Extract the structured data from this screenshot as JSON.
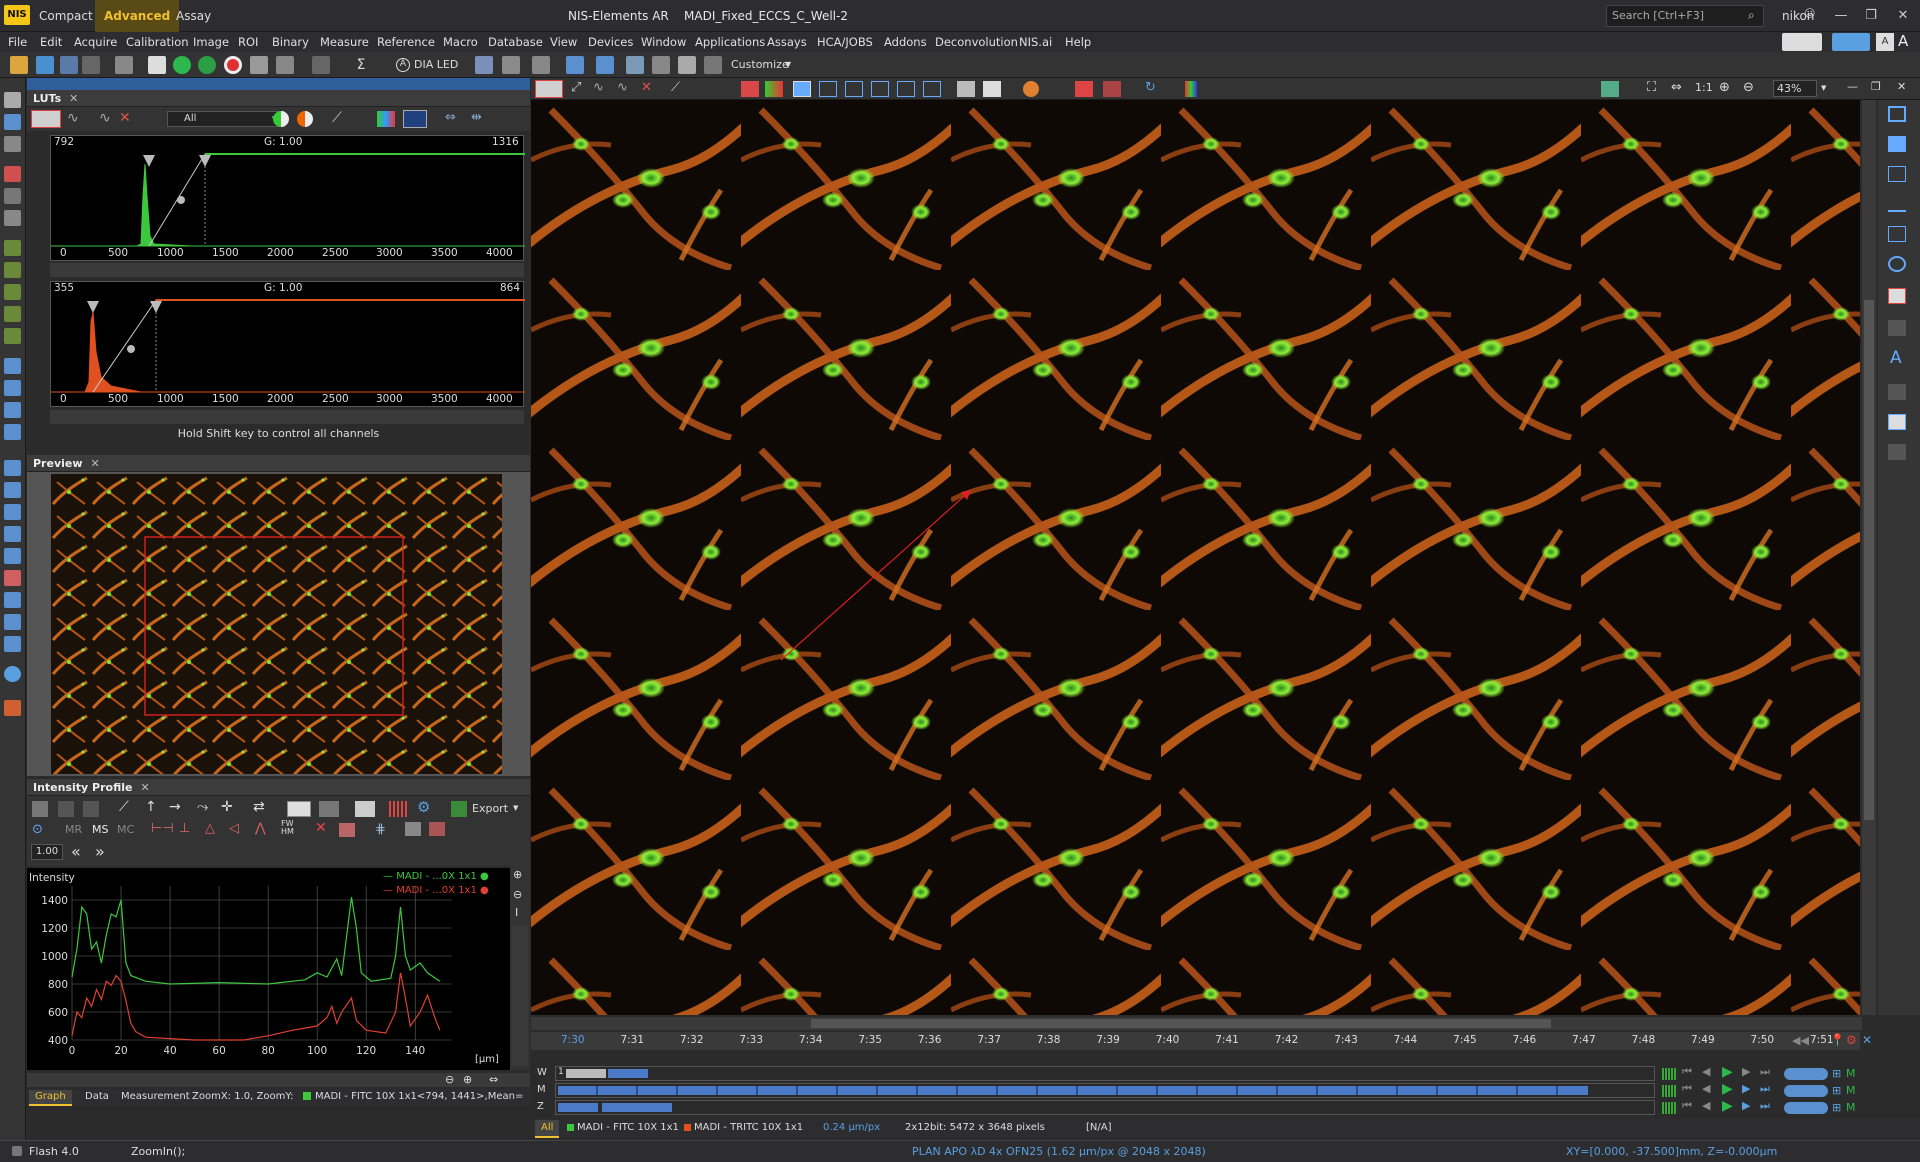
{
  "titlebar": {
    "logo": "NIS",
    "modes": [
      "Compact",
      "Advanced",
      "Assay"
    ],
    "title": "NIS-Elements AR    MADI_Fixed_ECCS_C_Well-2",
    "search_placeholder": "Search [Ctrl+F3]",
    "user": "nikon"
  },
  "menu": [
    "File",
    "Edit",
    "Acquire",
    "Calibration",
    "Image",
    "ROI",
    "Binary",
    "Measure",
    "Reference",
    "Macro",
    "Database",
    "View",
    "Devices",
    "Window",
    "Applications",
    "Assays",
    "HCA/JOBS",
    "Addons",
    "Deconvolution",
    "NIS.ai",
    "Help"
  ],
  "toolbar": {
    "dia_led": "DIA LED",
    "customize": "Customize"
  },
  "luts": {
    "title": "LUTs",
    "channel_select": "All",
    "ch1": {
      "min": "792",
      "gamma": "G: 1.00",
      "max": "1316",
      "color": "#3cc83c"
    },
    "ch2": {
      "min": "355",
      "gamma": "G: 1.00",
      "max": "864",
      "color": "#e05020"
    },
    "axis": [
      "0",
      "500",
      "1000",
      "1500",
      "2000",
      "2500",
      "3000",
      "3500",
      "4000"
    ],
    "hint": "Hold Shift key to control all channels"
  },
  "preview": {
    "title": "Preview"
  },
  "intensity": {
    "title": "Intensity Profile",
    "export": "Export",
    "mr": "MR",
    "ms": "MS",
    "mc": "MC",
    "fwhm": "FW HM",
    "zoom_value": "1.00",
    "ylabel": "Intensity",
    "xunit": "[µm]",
    "yticks": [
      "1400",
      "1200",
      "1000",
      "800",
      "600",
      "400"
    ],
    "xticks": [
      "0",
      "20",
      "40",
      "60",
      "80",
      "100",
      "120",
      "140"
    ],
    "legend": [
      "MADI - ...0X 1x1",
      "MADI - ...0X 1x1"
    ],
    "tabs": [
      "Graph",
      "Data",
      "Measurement"
    ],
    "zoom_info": "ZoomX: 1.0, ZoomY:",
    "channel_info": "MADI - FITC 10X 1x1<794, 1441>,Mean="
  },
  "viewer": {
    "zoom": "43%",
    "ratio": "1:1"
  },
  "timeline": {
    "ticks": [
      "7:30",
      "7:31",
      "7:32",
      "7:33",
      "7:34",
      "7:35",
      "7:36",
      "7:37",
      "7:38",
      "7:39",
      "7:40",
      "7:41",
      "7:42",
      "7:43",
      "7:44",
      "7:45",
      "7:46",
      "7:47",
      "7:48",
      "7:49",
      "7:50",
      "7:51"
    ],
    "rows": [
      "W",
      "M",
      "Z"
    ],
    "w_value": "1"
  },
  "chtabs": {
    "all": "All",
    "fitc": "MADI - FITC 10X 1x1",
    "tritc": "MADI - TRITC 10X 1x1",
    "pixel": "0.24 µm/px",
    "size": "2x12bit: 5472 x 3648 pixels",
    "na": "[N/A]"
  },
  "status": {
    "flash": "Flash 4.0",
    "cmd": "ZoomIn();",
    "objective": "PLAN APO λD 4x OFN25 (1.62 µm/px @ 2048 x 2048)",
    "coords": "XY=[0.000, -37.500]mm, Z=-0.000µm"
  }
}
